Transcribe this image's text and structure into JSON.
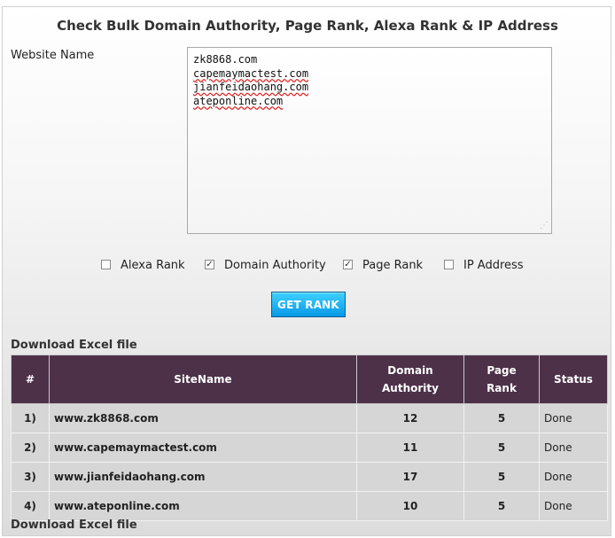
{
  "page": {
    "title": "Check Bulk Domain Authority, Page Rank, Alexa Rank & IP Address",
    "website_label": "Website Name",
    "domains": [
      "zk8868.com",
      "capemaymactest.com",
      "jianfeidaohang.com",
      "ateponline.com"
    ],
    "misspelled_lines": [
      1,
      2,
      3
    ]
  },
  "options": [
    {
      "label": "Alexa Rank",
      "checked": false
    },
    {
      "label": "Domain Authority",
      "checked": true
    },
    {
      "label": "Page Rank",
      "checked": true
    },
    {
      "label": "IP Address",
      "checked": false
    }
  ],
  "button": {
    "label": "GET RANK"
  },
  "download_label": "Download Excel file",
  "table": {
    "headers": {
      "num": "#",
      "site": "SiteName",
      "da_line1": "Domain",
      "da_line2": "Authority",
      "pr_line1": "Page",
      "pr_line2": "Rank",
      "status": "Status"
    },
    "rows": [
      {
        "num": "1)",
        "site": "www.zk8868.com",
        "da": "12",
        "pr": "5",
        "status": "Done"
      },
      {
        "num": "2)",
        "site": "www.capemaymactest.com",
        "da": "11",
        "pr": "5",
        "status": "Done"
      },
      {
        "num": "3)",
        "site": "www.jianfeidaohang.com",
        "da": "17",
        "pr": "5",
        "status": "Done"
      },
      {
        "num": "4)",
        "site": "www.ateponline.com",
        "da": "10",
        "pr": "5",
        "status": "Done"
      }
    ]
  },
  "colors": {
    "header_bg": "#4d3149",
    "button_top": "#3fd0ff",
    "button_bottom": "#0899e6",
    "row_bg": "#d6d6d6"
  }
}
